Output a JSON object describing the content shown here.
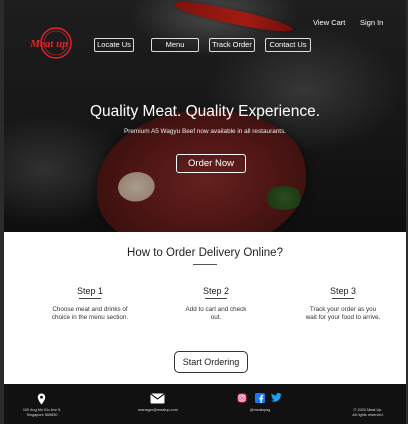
{
  "header": {
    "logo_text": "Meat up",
    "nav": [
      {
        "label": "Locate Us"
      },
      {
        "label": "Menu"
      },
      {
        "label": "Track Order"
      },
      {
        "label": "Contact Us"
      }
    ],
    "view_cart": "View Cart",
    "sign_in": "Sign In"
  },
  "hero": {
    "title": "Quality Meat. Quality Experience.",
    "subtitle": "Premium A5 Wagyu Beef now available in all restaurants.",
    "cta": "Order Now"
  },
  "how": {
    "title": "How to Order Delivery Online?",
    "steps": [
      {
        "title": "Step 1",
        "desc": "Choose meat and drinks of choice in the menu section."
      },
      {
        "title": "Step 2",
        "desc": "Add to cart and check out."
      },
      {
        "title": "Step 3",
        "desc": "Track your order as you wait for your food to arrive."
      }
    ],
    "cta": "Start Ordering"
  },
  "footer": {
    "address_line1": "100 Ang Mo Kio Ave 5,",
    "address_line2": "Singapore 569830",
    "email": "manager@meatup.com",
    "social_handle": "@meatupsg",
    "copyright": "© 2020 Meat Up.",
    "rights": "All rights reserved."
  },
  "colors": {
    "logo_red": "#e4232b",
    "footer_bg": "#111111",
    "instagram": "#e1306c",
    "facebook": "#1877f2",
    "twitter": "#1da1f2"
  }
}
